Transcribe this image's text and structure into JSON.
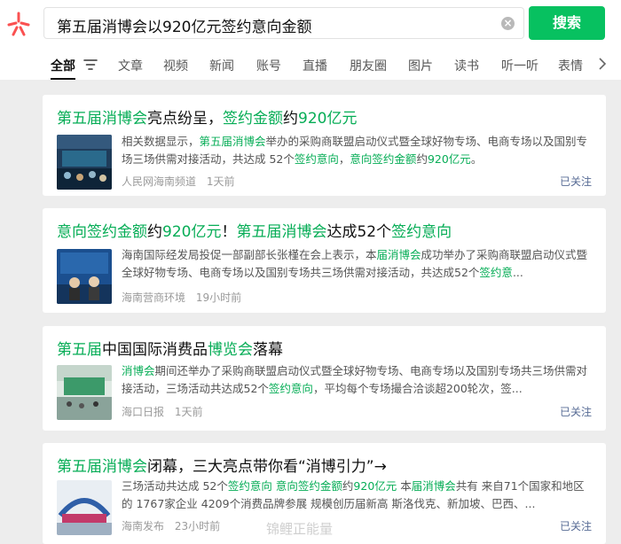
{
  "search": {
    "query": "第五届消博会以920亿元签约意向金额",
    "button_label": "搜索"
  },
  "tabs": [
    {
      "label": "全部",
      "active": true
    },
    {
      "label": "文章"
    },
    {
      "label": "视频"
    },
    {
      "label": "新闻"
    },
    {
      "label": "账号"
    },
    {
      "label": "直播"
    },
    {
      "label": "朋友圈"
    },
    {
      "label": "图片"
    },
    {
      "label": "读书"
    },
    {
      "label": "听一听"
    },
    {
      "label": "表情"
    }
  ],
  "results": [
    {
      "title_segments": [
        {
          "text": "第五届消博会",
          "hl": true
        },
        {
          "text": "亮点纷呈，",
          "hl": false
        },
        {
          "text": "签约金额",
          "hl": true
        },
        {
          "text": "约",
          "hl": false
        },
        {
          "text": "920亿元",
          "hl": true
        }
      ],
      "snippet_segments": [
        {
          "text": "相关数据显示，",
          "hl": false
        },
        {
          "text": "第五届消博会",
          "hl": true
        },
        {
          "text": "举办的采购商联盟启动仪式暨全球好物专场、电商专场以及国别专场三场供需对接活动，共达成 52个",
          "hl": false
        },
        {
          "text": "签约意向",
          "hl": true
        },
        {
          "text": "，",
          "hl": false
        },
        {
          "text": "意向签约金额",
          "hl": true
        },
        {
          "text": "约",
          "hl": false
        },
        {
          "text": "920亿元",
          "hl": true
        },
        {
          "text": "。",
          "hl": false
        }
      ],
      "source": "人民网海南频道",
      "time": "1天前",
      "follow": "已关注"
    },
    {
      "title_segments": [
        {
          "text": "意向签约金额",
          "hl": true
        },
        {
          "text": "约",
          "hl": false
        },
        {
          "text": "920亿元",
          "hl": true
        },
        {
          "text": "！",
          "hl": false
        },
        {
          "text": "第五届消博会",
          "hl": true
        },
        {
          "text": "达成52个",
          "hl": false
        },
        {
          "text": "签约意向",
          "hl": true
        }
      ],
      "snippet_segments": [
        {
          "text": "海南国际经发局投促一部副部长张槿在会上表示，本",
          "hl": false
        },
        {
          "text": "届消博会",
          "hl": true
        },
        {
          "text": "成功举办了采购商联盟启动仪式暨全球好物专场、电商专场以及国别专场共三场供需对接活动，共达成52个",
          "hl": false
        },
        {
          "text": "签约意",
          "hl": true
        },
        {
          "text": "...",
          "hl": false
        }
      ],
      "source": "海南营商环境",
      "time": "19小时前",
      "follow": ""
    },
    {
      "title_segments": [
        {
          "text": "第五届",
          "hl": true
        },
        {
          "text": "中国国际消费品",
          "hl": false
        },
        {
          "text": "博览会",
          "hl": true
        },
        {
          "text": "落幕",
          "hl": false
        }
      ],
      "snippet_segments": [
        {
          "text": "消博会",
          "hl": true
        },
        {
          "text": "期间还举办了采购商联盟启动仪式暨全球好物专场、电商专场以及国别专场共三场供需对接活动，三场活动共达成52个",
          "hl": false
        },
        {
          "text": "签约意向",
          "hl": true
        },
        {
          "text": "，平均每个专场撮合洽谈超200轮次，签...",
          "hl": false
        }
      ],
      "source": "海口日报",
      "time": "1天前",
      "follow": "已关注"
    },
    {
      "title_segments": [
        {
          "text": "第五届消博会",
          "hl": true
        },
        {
          "text": "闭幕，三大亮点带你看“消博引力”→",
          "hl": false
        }
      ],
      "snippet_segments": [
        {
          "text": "三场活动共达成 52个",
          "hl": false
        },
        {
          "text": "签约意向",
          "hl": true
        },
        {
          "text": " ",
          "hl": false
        },
        {
          "text": "意向签约金额",
          "hl": true
        },
        {
          "text": "约",
          "hl": false
        },
        {
          "text": "920亿元",
          "hl": true
        },
        {
          "text": " 本",
          "hl": false
        },
        {
          "text": "届消博会",
          "hl": true
        },
        {
          "text": "共有 来自71个国家和地区的 1767家企业 4209个消费品牌参展 规模创历届新高 斯洛伐克、新加坡、巴西、...",
          "hl": false
        }
      ],
      "source": "海南发布",
      "time": "23小时前",
      "follow": "已关注"
    }
  ],
  "watermark": "锦鲤正能量",
  "colors": {
    "accent": "#07c160",
    "highlight": "#06ad56",
    "follow_link": "#576b95"
  }
}
